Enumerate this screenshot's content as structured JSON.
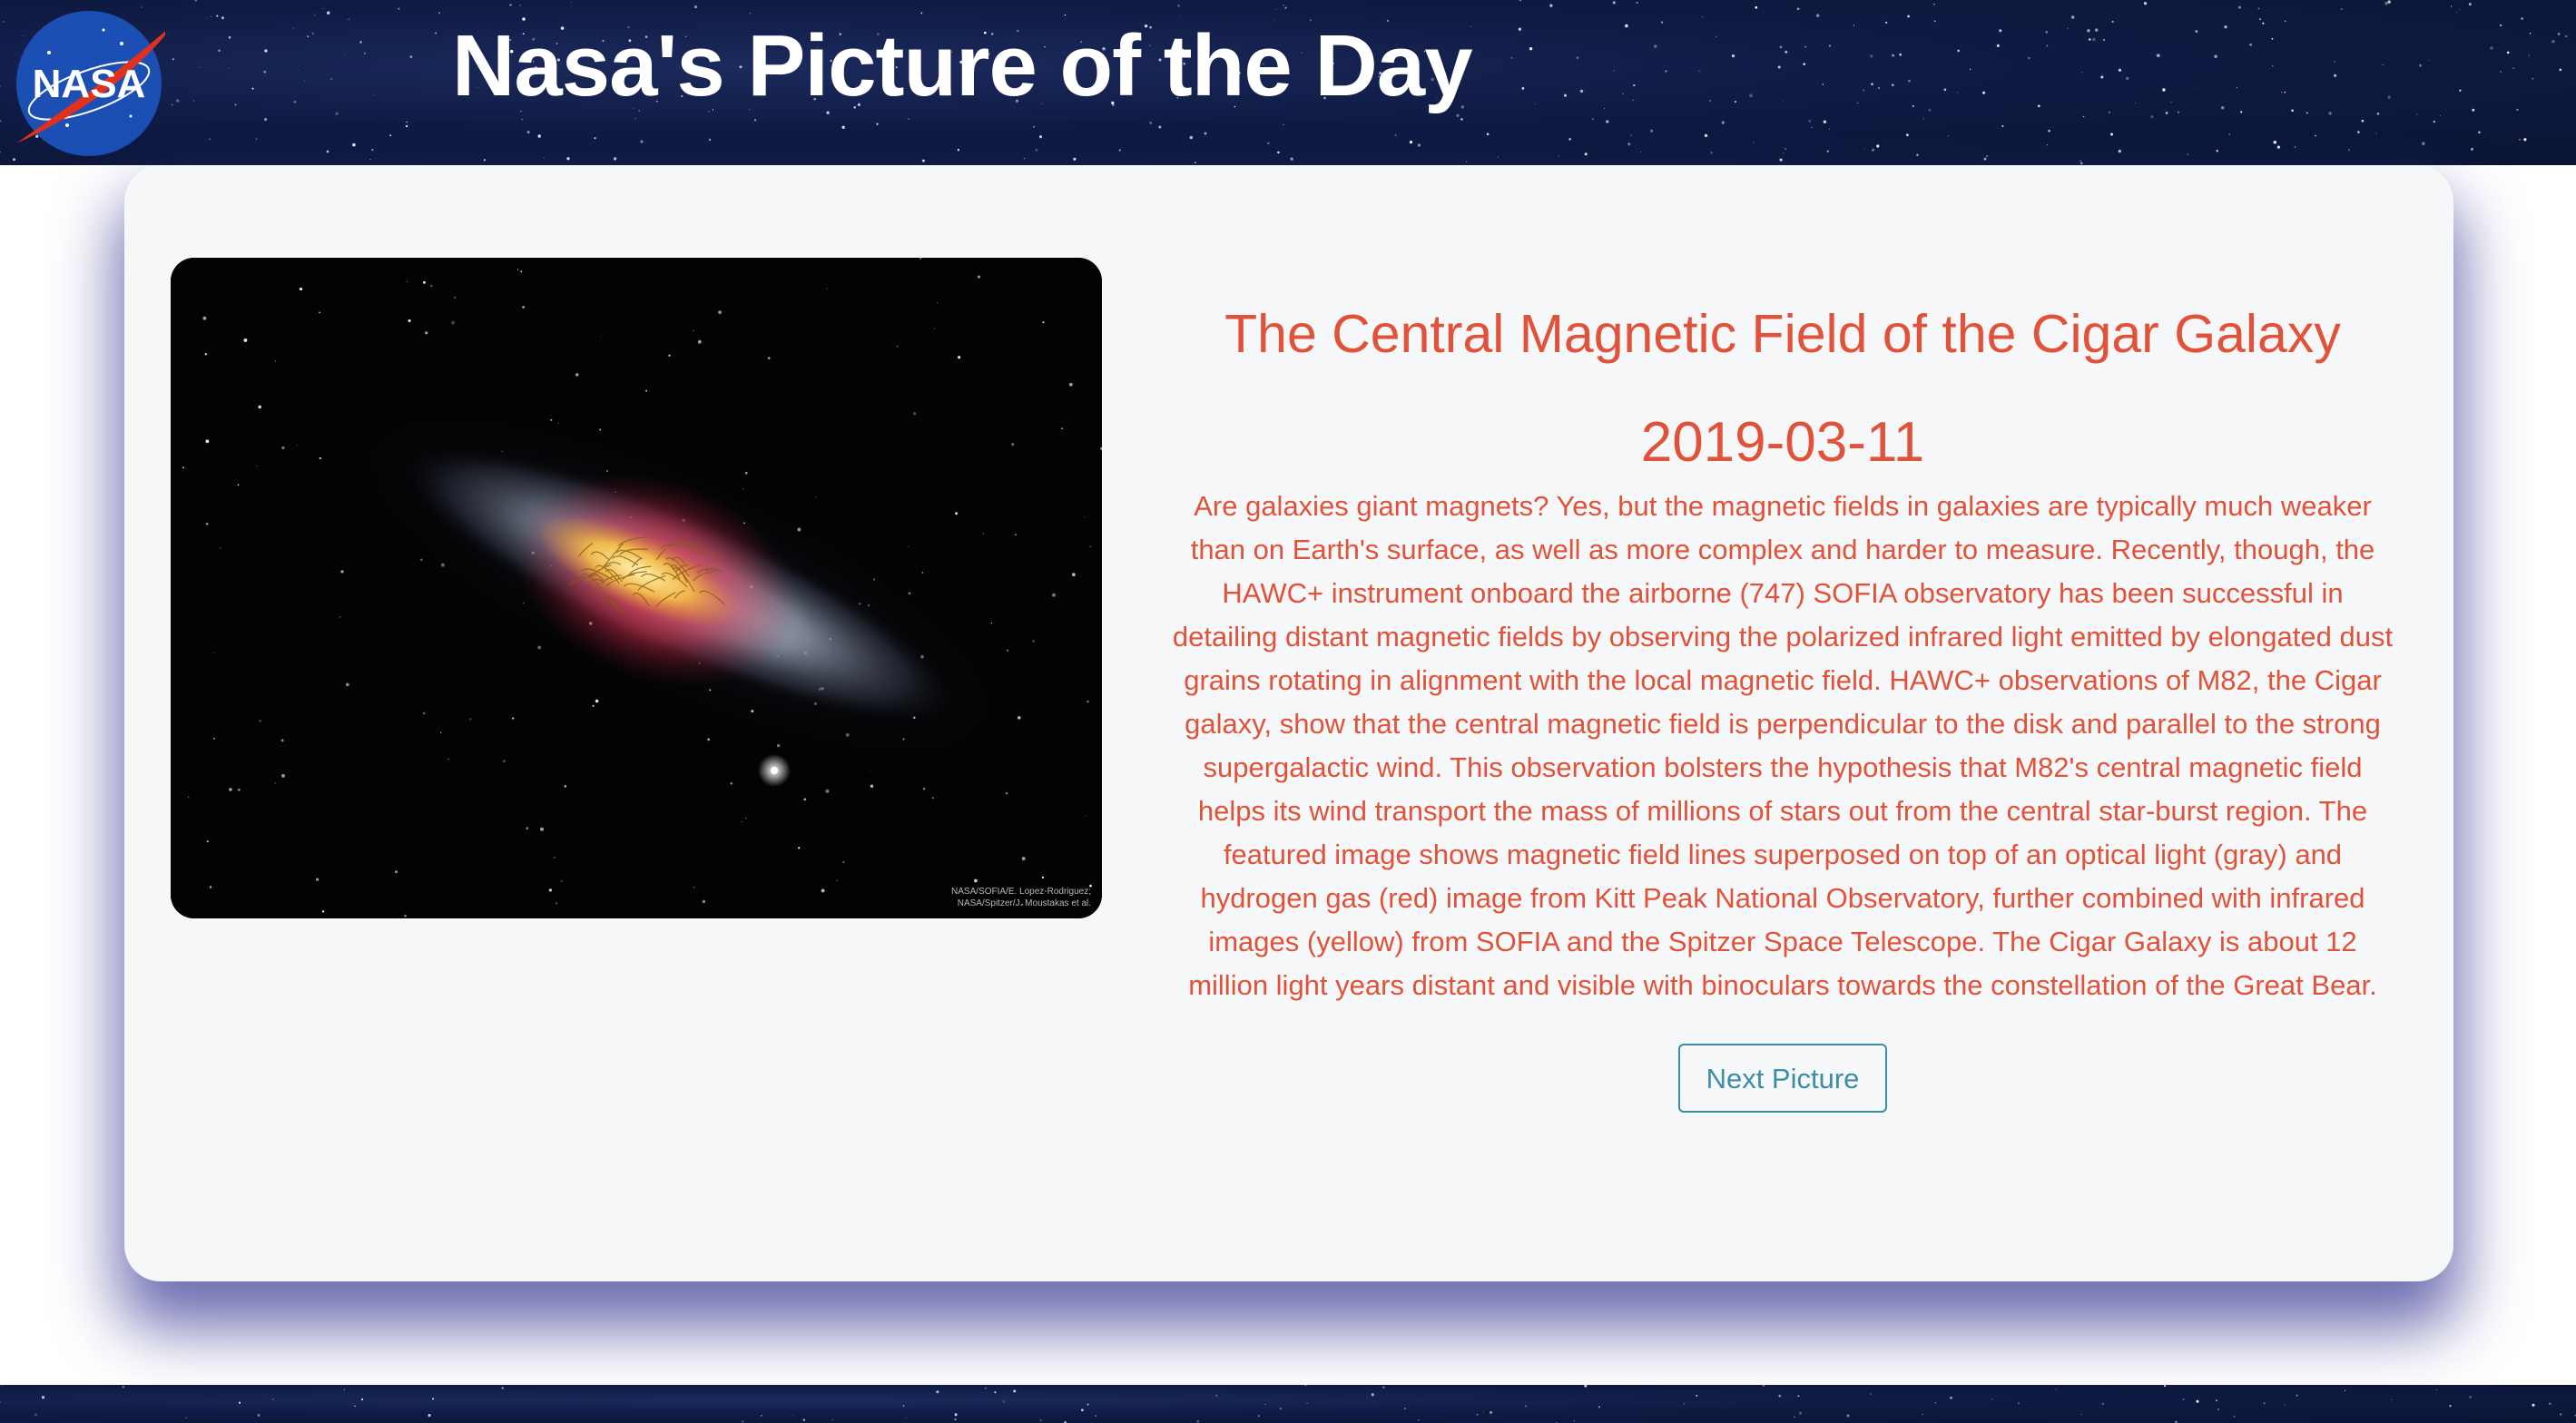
{
  "header": {
    "logo_text": "NASA",
    "title": "Nasa's Picture of the Day"
  },
  "apod": {
    "title": "The Central Magnetic Field of the Cigar Galaxy",
    "date": "2019-03-11",
    "explanation": "Are galaxies giant magnets? Yes, but the magnetic fields in galaxies are typically much weaker than on Earth's surface, as well as more complex and harder to measure. Recently, though, the HAWC+ instrument onboard the airborne (747) SOFIA observatory has been successful in detailing distant magnetic fields by observing the polarized infrared light emitted by elongated dust grains rotating in alignment with the local magnetic field. HAWC+ observations of M82, the Cigar galaxy, show that the central magnetic field is perpendicular to the disk and parallel to the strong supergalactic wind. This observation bolsters the hypothesis that M82's central magnetic field helps its wind transport the mass of millions of stars out from the central star-burst region. The featured image shows magnetic field lines superposed on top of an optical light (gray) and hydrogen gas (red) image from Kitt Peak National Observatory, further combined with infrared images (yellow) from SOFIA and the Spitzer Space Telescope. The Cigar Galaxy is about 12 million light years distant and visible with binoculars towards the constellation of the Great Bear.",
    "image_credit": "NASA/SOFIA/E. Lopez-Rodriguez;\nNASA/Spitzer/J. Moustakas et al.",
    "next_button_label": "Next Picture"
  },
  "colors": {
    "accent_text": "#e05239",
    "button": "#3b8ea5",
    "header_background": "#0f1b44",
    "card_background": "#f6f7f8"
  }
}
